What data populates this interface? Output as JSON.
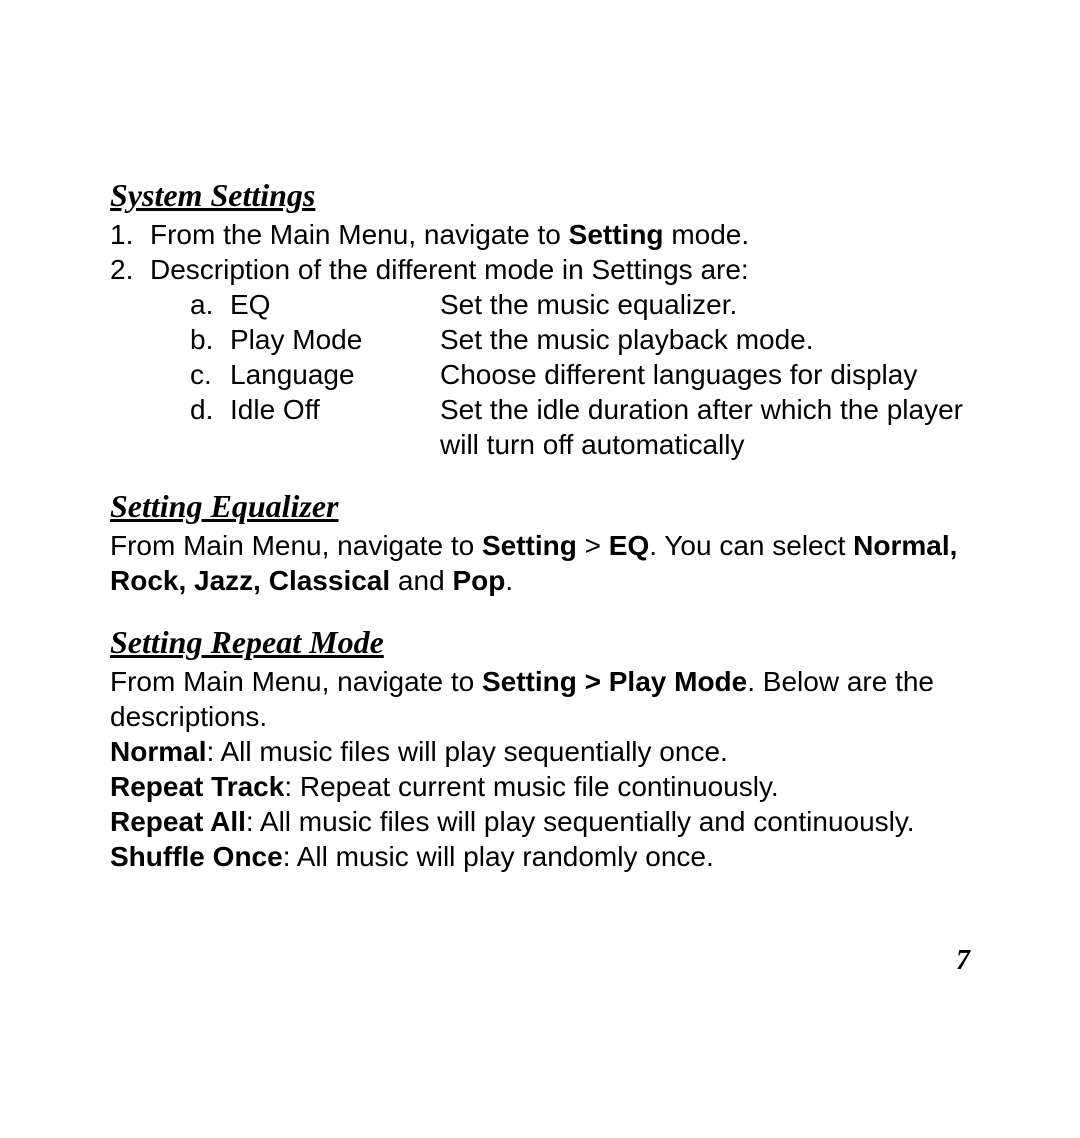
{
  "page_number": "7",
  "sections": {
    "system_settings": {
      "heading": "System Settings",
      "step1_num": "1.",
      "step1_pre": "From the Main Menu, navigate to ",
      "step1_bold": "Setting",
      "step1_post": " mode.",
      "step2_num": "2.",
      "step2_text": "Description of the different mode in Settings are:",
      "items": [
        {
          "letter": "a.",
          "label": "EQ",
          "desc": "Set the music equalizer."
        },
        {
          "letter": "b.",
          "label": "Play Mode",
          "desc": "Set the music playback mode."
        },
        {
          "letter": "c.",
          "label": "Language",
          "desc": "Choose different languages for display"
        },
        {
          "letter": "d.",
          "label": "Idle Off",
          "desc": "Set the idle duration after which the player will turn off automatically"
        }
      ]
    },
    "equalizer": {
      "heading": "Setting Equalizer",
      "pre1": "From Main Menu, navigate to ",
      "b1": "Setting",
      "gt": " > ",
      "b2": "EQ",
      "post1": ". You can select ",
      "b3": "Normal, Rock, Jazz, Classical",
      "and": " and ",
      "b4": "Pop",
      "post2": "."
    },
    "repeat": {
      "heading": "Setting Repeat Mode",
      "pre1": "From Main Menu, navigate to ",
      "b1": "Setting > Play Mode",
      "post1": ". Below are the descriptions.",
      "modes": [
        {
          "name": "Normal",
          "desc": ": All music files will play sequentially once."
        },
        {
          "name": "Repeat Track",
          "desc": ": Repeat current music file continuously."
        },
        {
          "name": "Repeat All",
          "desc": ": All music files will play sequentially and continuously."
        },
        {
          "name": "Shuffle Once",
          "desc": ": All music will play randomly once."
        }
      ]
    }
  }
}
